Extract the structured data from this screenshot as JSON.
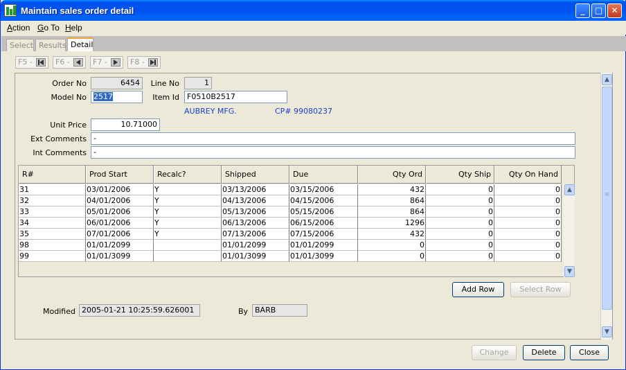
{
  "window": {
    "title": "Maintain sales order detail",
    "min_label": "_",
    "max_label": "□",
    "close_label": "✕"
  },
  "menu": [
    {
      "label": "Action"
    },
    {
      "label": "Go To"
    },
    {
      "label": "Help"
    }
  ],
  "tabs": [
    {
      "label": "Select"
    },
    {
      "label": "Results"
    },
    {
      "label": "Detail"
    }
  ],
  "nav": [
    {
      "label": "F5 -"
    },
    {
      "label": "F6 -"
    },
    {
      "label": "F7 -"
    },
    {
      "label": "F8 -"
    }
  ],
  "form": {
    "order_no_label": "Order No",
    "order_no": "6454",
    "line_no_label": "Line No",
    "line_no": "1",
    "model_no_label": "Model No",
    "model_no": "2517",
    "item_id_label": "Item Id",
    "item_id": "F0510B2517",
    "vendor": "AUBREY MFG.",
    "cp": "CP# 99080237",
    "unit_price_label": "Unit Price",
    "unit_price": "10.71000",
    "ext_comments_label": "Ext Comments",
    "ext_comments": "-",
    "int_comments_label": "Int Comments",
    "int_comments": "-",
    "modified_label": "Modified",
    "modified": "2005-01-21 10:25:59.626001",
    "by_label": "By",
    "by": "BARB"
  },
  "table": {
    "headers": [
      "R#",
      "Prod Start",
      "Recalc?",
      "Shipped",
      "Due",
      "Qty Ord",
      "Qty Ship",
      "Qty On Hand"
    ],
    "rows": [
      [
        "31",
        "03/01/2006",
        "Y",
        "03/13/2006",
        "03/15/2006",
        "432",
        "0",
        "0"
      ],
      [
        "32",
        "04/01/2006",
        "Y",
        "04/13/2006",
        "04/15/2006",
        "864",
        "0",
        "0"
      ],
      [
        "33",
        "05/01/2006",
        "Y",
        "05/13/2006",
        "05/15/2006",
        "864",
        "0",
        "0"
      ],
      [
        "34",
        "06/01/2006",
        "Y",
        "06/13/2006",
        "06/15/2006",
        "1296",
        "0",
        "0"
      ],
      [
        "35",
        "07/01/2006",
        "Y",
        "07/13/2006",
        "07/15/2006",
        "432",
        "0",
        "0"
      ],
      [
        "98",
        "01/01/2099",
        "",
        "01/01/2099",
        "01/01/2099",
        "0",
        "0",
        "0"
      ],
      [
        "99",
        "01/01/3099",
        "",
        "01/01/3099",
        "01/01/3099",
        "0",
        "0",
        "0"
      ]
    ]
  },
  "buttons": {
    "add_row": "Add Row",
    "select_row": "Select Row",
    "change": "Change",
    "delete": "Delete",
    "close": "Close"
  }
}
